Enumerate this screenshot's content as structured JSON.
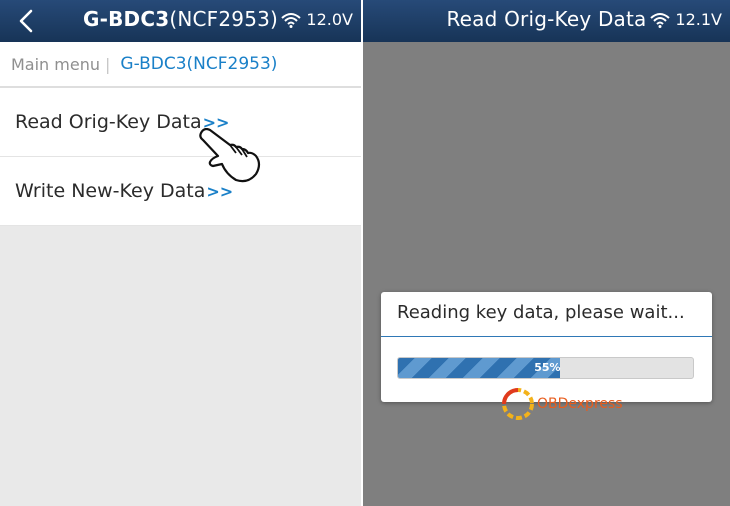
{
  "left_screen": {
    "title": "G-BDC3",
    "title_code": "(NCF2953)",
    "battery_voltage": "12.0V",
    "breadcrumb": {
      "main": "Main menu",
      "separator": "|",
      "current": "G-BDC3(NCF2953)"
    },
    "menu_items": [
      {
        "label": "Read Orig-Key Data",
        "arrow": ">>"
      },
      {
        "label": "Write New-Key Data",
        "arrow": ">>"
      }
    ]
  },
  "right_screen": {
    "title": "Read Orig-Key Data",
    "battery_voltage": "12.1V",
    "dialog": {
      "message": "Reading key data, please wait...",
      "progress_percent": 55,
      "progress_label": "55%"
    },
    "watermark": "OBDexpress"
  },
  "icons": {
    "back": "chevron-left-icon",
    "wifi": "wifi-icon",
    "pointer": "pointing-hand-icon"
  },
  "colors": {
    "titlebar": "#1f3f68",
    "accent": "#1a80c8",
    "progress": "#2f71b0",
    "overlay": "#7f7f7f",
    "watermark": "#e85c1c"
  }
}
